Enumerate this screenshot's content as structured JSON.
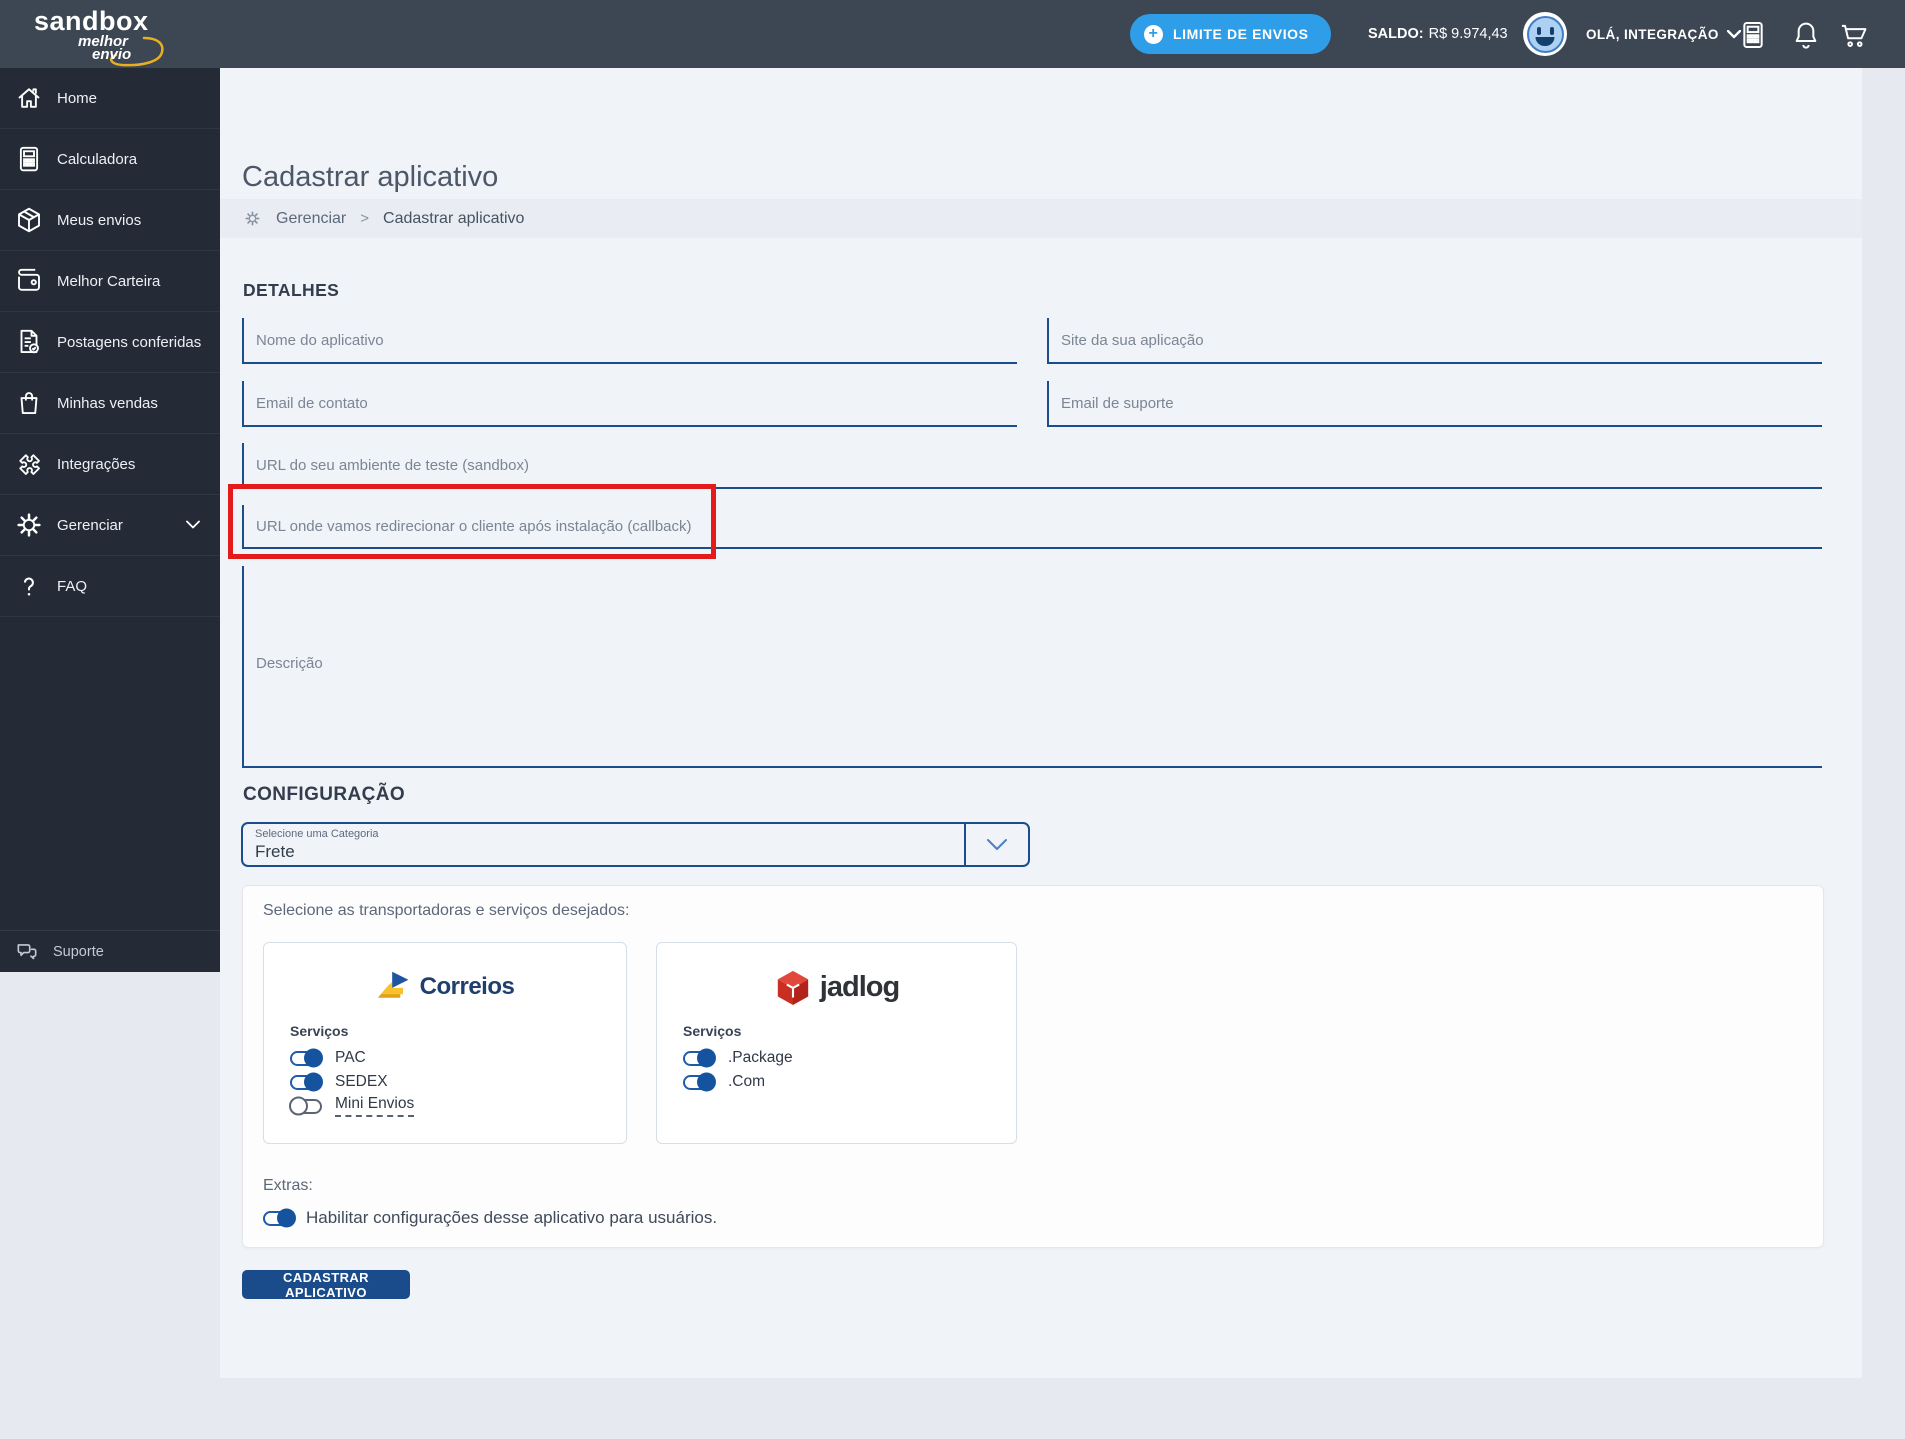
{
  "header": {
    "logo": {
      "line1": "sandbox",
      "line2": "melhor",
      "line3": "envio"
    },
    "limit_button_label": "LIMITE DE ENVIOS",
    "balance_label": "SALDO:",
    "balance_value": "R$ 9.974,43",
    "greeting": "OLÁ, INTEGRAÇÃO"
  },
  "sidebar": {
    "items": [
      {
        "label": "Home",
        "icon": "home-icon"
      },
      {
        "label": "Calculadora",
        "icon": "calculator-icon"
      },
      {
        "label": "Meus envios",
        "icon": "package-icon"
      },
      {
        "label": "Melhor Carteira",
        "icon": "wallet-icon"
      },
      {
        "label": "Postagens conferidas",
        "icon": "document-check-icon"
      },
      {
        "label": "Minhas vendas",
        "icon": "shopping-bag-icon"
      },
      {
        "label": "Integrações",
        "icon": "puzzle-icon"
      },
      {
        "label": "Gerenciar",
        "icon": "gear-icon"
      },
      {
        "label": "FAQ",
        "icon": "question-icon"
      }
    ],
    "support": {
      "label": "Suporte",
      "icon": "chat-bubbles-icon"
    }
  },
  "page": {
    "title": "Cadastrar aplicativo",
    "breadcrumb": {
      "parent": "Gerenciar",
      "separator": ">",
      "current": "Cadastrar aplicativo"
    }
  },
  "form": {
    "details_heading": "DETALHES",
    "fields": {
      "app_name": {
        "placeholder": "Nome do aplicativo",
        "value": ""
      },
      "site": {
        "placeholder": "Site da sua aplicação",
        "value": ""
      },
      "contact_email": {
        "placeholder": "Email de contato",
        "value": ""
      },
      "support_email": {
        "placeholder": "Email de suporte",
        "value": ""
      },
      "sandbox_url": {
        "placeholder": "URL do seu ambiente de teste (sandbox)",
        "value": ""
      },
      "callback_url": {
        "placeholder": "URL onde vamos redirecionar o cliente após instalação (callback)",
        "value": "",
        "highlighted": true
      },
      "description": {
        "placeholder": "Descrição",
        "value": ""
      }
    },
    "config_heading": "CONFIGURAÇÃO",
    "category_select": {
      "label": "Selecione uma Categoria",
      "value": "Frete"
    },
    "carriers_section": {
      "intro": "Selecione as transportadoras e serviços desejados:",
      "carriers": [
        {
          "name": "Correios",
          "services_label": "Serviços",
          "services": [
            {
              "name": "PAC",
              "enabled": true
            },
            {
              "name": "SEDEX",
              "enabled": true
            },
            {
              "name": "Mini Envios",
              "enabled": false,
              "dashed_underline": true
            }
          ]
        },
        {
          "name": "jadlog",
          "services_label": "Serviços",
          "services": [
            {
              "name": ".Package",
              "enabled": true
            },
            {
              "name": ".Com",
              "enabled": true
            }
          ]
        }
      ],
      "extras_label": "Extras:",
      "extras_toggle": {
        "label": "Habilitar configurações desse aplicativo para usuários.",
        "enabled": true
      }
    },
    "submit_button": "CADASTRAR APLICATIVO"
  },
  "colors": {
    "header_bg": "#3d4653",
    "sidebar_bg": "#242b36",
    "main_bg": "#f0f3f7",
    "breadcrumb_bg": "#e9edf3",
    "accent_blue": "#2f9ee8",
    "field_border_navy": "#1b4d8c",
    "toggle_on_blue": "#15539e",
    "highlight_red": "#e31b1c",
    "button_navy": "#1a4c8b",
    "correios_navy": "#1f3f6e",
    "correios_gold": "#f7c22b",
    "jadlog_red": "#d6392e"
  }
}
